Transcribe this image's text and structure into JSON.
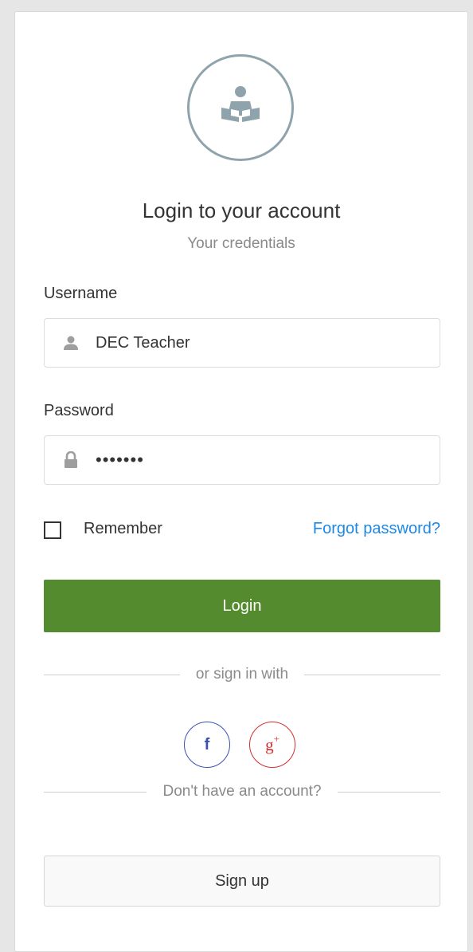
{
  "header": {
    "title": "Login to your account",
    "subtitle": "Your credentials",
    "logo_icon": "teacher-reading-icon"
  },
  "username": {
    "label": "Username",
    "value": "DEC Teacher",
    "icon": "user-icon"
  },
  "password": {
    "label": "Password",
    "value": "•••••••",
    "icon": "lock-icon"
  },
  "remember": {
    "label": "Remember",
    "checked": false
  },
  "forgot_password": {
    "label": "Forgot password?"
  },
  "login_button": {
    "label": "Login"
  },
  "social": {
    "divider_label": "or sign in with",
    "facebook_label": "f",
    "google_label": "g",
    "google_sup": "+"
  },
  "signup": {
    "divider_label": "Don't have an account?",
    "button_label": "Sign up"
  },
  "colors": {
    "primary_button": "#558b2f",
    "link": "#1e88e5",
    "facebook": "#3b50b3",
    "google": "#d32f2f",
    "logo_ring": "#8fa3ad"
  }
}
